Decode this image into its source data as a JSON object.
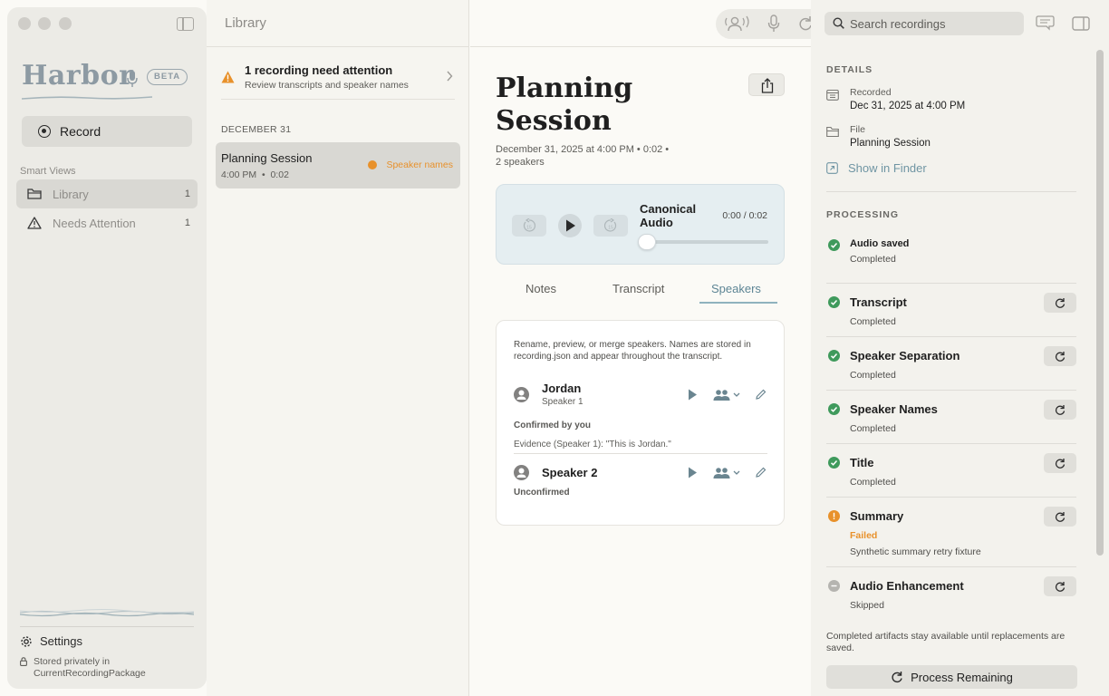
{
  "sidebar": {
    "logo_text": "Harbor",
    "beta_label": "BETA",
    "record_label": "Record",
    "smart_views_label": "Smart Views",
    "items": [
      {
        "label": "Library",
        "count": "1"
      },
      {
        "label": "Needs Attention",
        "count": "1"
      }
    ],
    "settings_label": "Settings",
    "storage_note": "Stored privately in CurrentRecordingPackage"
  },
  "list": {
    "header": "Library",
    "attention_title": "1 recording need attention",
    "attention_sub": "Review transcripts and speaker names",
    "date_group": "DECEMBER 31",
    "recordings": [
      {
        "title": "Planning Session",
        "time": "4:00 PM",
        "duration": "0:02",
        "badge": "Speaker names"
      }
    ]
  },
  "detail": {
    "title": "Planning Session",
    "meta_line1": "December 31, 2025 at 4:00 PM  •  0:02  •",
    "meta_line2": "2 speakers",
    "player": {
      "title": "Canonical Audio",
      "time": "0:00 / 0:02",
      "skip_back": "15",
      "skip_fwd": "15"
    },
    "tabs": [
      "Notes",
      "Transcript",
      "Speakers"
    ],
    "active_tab": "Speakers",
    "speakers_desc": "Rename, preview, or merge speakers. Names are stored in recording.json and appear throughout the transcript.",
    "speakers": [
      {
        "name": "Jordan",
        "role": "Speaker 1",
        "status": "Confirmed by you",
        "evidence": "Evidence (Speaker 1): \"This is Jordan.\""
      },
      {
        "name": "Speaker 2",
        "role": "",
        "status": "Unconfirmed",
        "evidence": ""
      }
    ]
  },
  "right": {
    "search_placeholder": "Search recordings",
    "details_heading": "DETAILS",
    "recorded_label": "Recorded",
    "recorded_value": "Dec 31, 2025 at 4:00 PM",
    "file_label": "File",
    "file_value": "Planning Session",
    "show_in_finder": "Show in Finder",
    "processing_heading": "PROCESSING",
    "steps": [
      {
        "name": "Audio saved",
        "status": "Completed",
        "state": "ok",
        "detail": ""
      },
      {
        "name": "Transcript",
        "status": "Completed",
        "state": "ok",
        "detail": ""
      },
      {
        "name": "Speaker Separation",
        "status": "Completed",
        "state": "ok",
        "detail": ""
      },
      {
        "name": "Speaker Names",
        "status": "Completed",
        "state": "ok",
        "detail": ""
      },
      {
        "name": "Title",
        "status": "Completed",
        "state": "ok",
        "detail": ""
      },
      {
        "name": "Summary",
        "status": "Failed",
        "state": "failed",
        "detail": "Synthetic summary retry fixture"
      },
      {
        "name": "Audio Enhancement",
        "status": "Skipped",
        "state": "skipped",
        "detail": ""
      }
    ],
    "note": "Completed artifacts stay available until replacements are saved.",
    "process_button": "Process Remaining"
  },
  "colors": {
    "accent": "#6f95a3",
    "success": "#3f9a5c",
    "warning": "#e8912b",
    "skipped": "#b5b4b0"
  }
}
